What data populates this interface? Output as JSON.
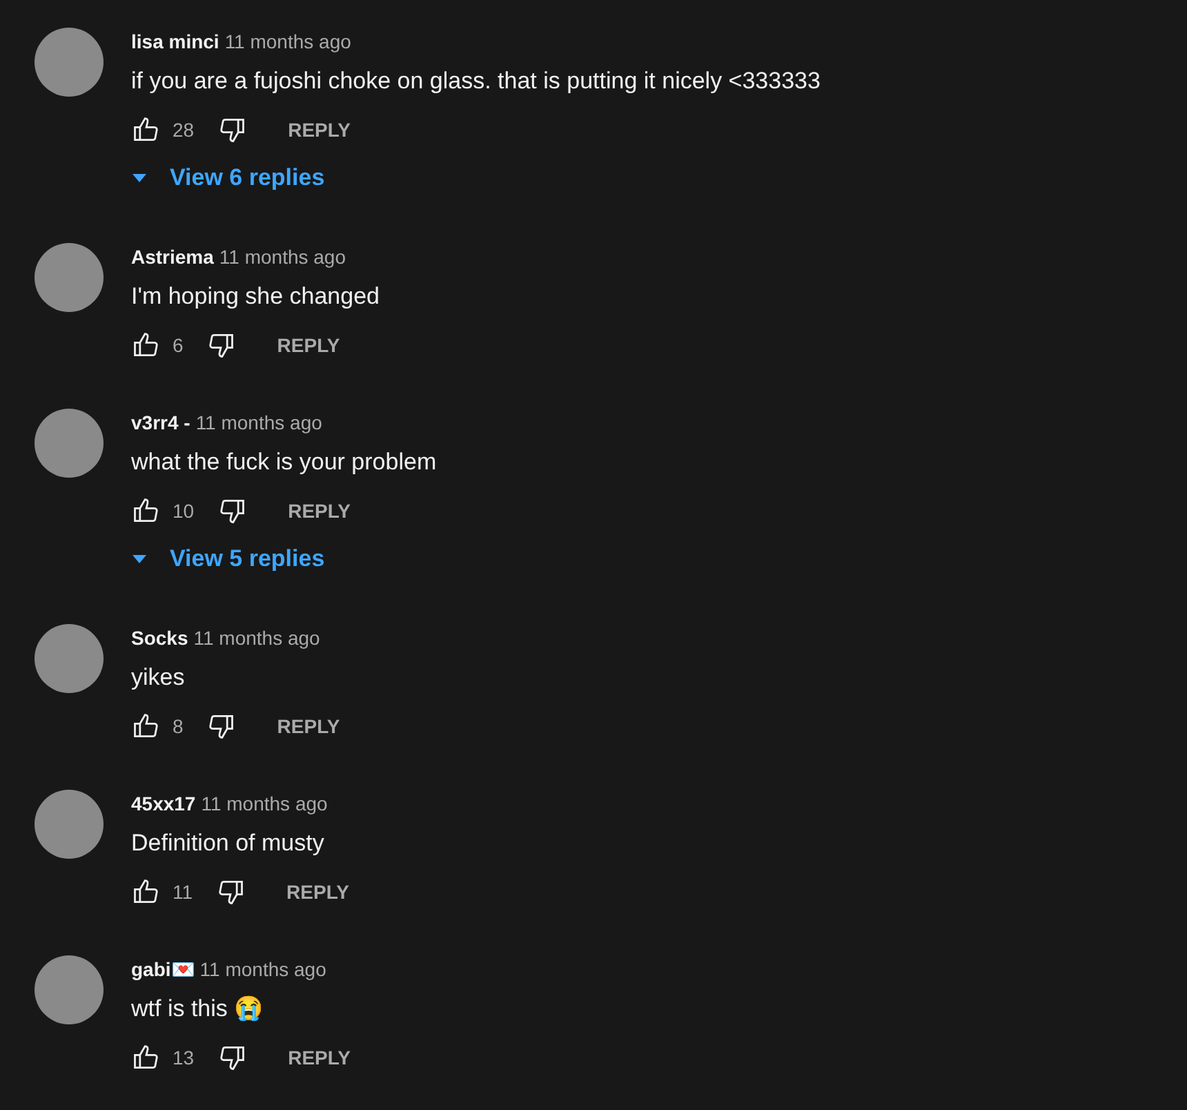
{
  "comments": [
    {
      "author": "lisa minci",
      "time": "11 months ago",
      "text": "if you are a fujoshi choke on glass. that is putting it nicely <333333",
      "likes": "28",
      "reply_label": "REPLY",
      "replies_label": "View 6 replies"
    },
    {
      "author": "Astriema",
      "time": "11 months ago",
      "text": "I'm hoping she changed",
      "likes": "6",
      "reply_label": "REPLY"
    },
    {
      "author": "v3rr4 -",
      "time": "11 months ago",
      "text": "what the fuck is your problem",
      "likes": "10",
      "reply_label": "REPLY",
      "replies_label": "View 5 replies"
    },
    {
      "author": "Socks",
      "time": "11 months ago",
      "text": "yikes",
      "likes": "8",
      "reply_label": "REPLY"
    },
    {
      "author": "45xx17",
      "time": "11 months ago",
      "text": "Definition of musty",
      "likes": "11",
      "reply_label": "REPLY"
    },
    {
      "author": "gabi💌",
      "time": "11 months ago",
      "text": "wtf is this 😭",
      "likes": "13",
      "reply_label": "REPLY"
    }
  ]
}
